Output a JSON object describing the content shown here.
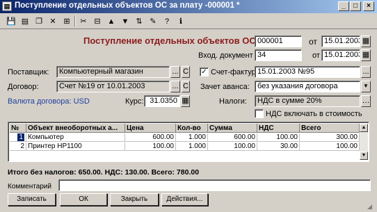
{
  "window": {
    "title": "Поступление отдельных объектов ОС за плату -000001 *",
    "title_icon": "doc-icon"
  },
  "toolbar": {
    "icons": [
      "save-icon",
      "print-icon",
      "copy-icon",
      "delete-icon",
      "mark-icon",
      "cut-icon",
      "struct-icon",
      "move-up-icon",
      "move-down-icon",
      "sort-icon",
      "edit-icon",
      "help-icon",
      "info-icon"
    ]
  },
  "header": {
    "doc_title": "Поступление отдельных объектов ОС №",
    "doc_number": "000001",
    "from_label": "от",
    "doc_date": "15.01.2003",
    "in_doc_label": "Вход. документ №",
    "in_doc_number": "34",
    "in_doc_from_label": "от",
    "in_doc_date": "15.01.2003"
  },
  "supplier": {
    "label": "Поставщик:",
    "value": "Компьютерный магазин",
    "btn_dots": "...",
    "btn_c": "С"
  },
  "invoice": {
    "label": "Счет-фактура:",
    "checked": true,
    "value": "15.01.2003 №95",
    "btn_dots": "..."
  },
  "contract": {
    "label": "Договор:",
    "value": "Счет №19 от 10.01.2003",
    "btn_dots": "...",
    "btn_c": "С"
  },
  "advance": {
    "label": "Зачет аванса:",
    "value": "без указания договора"
  },
  "currency": {
    "label": "Валюта договора: USD"
  },
  "rate": {
    "label": "Курс:",
    "value": "31.0350"
  },
  "taxes": {
    "label": "Налоги:",
    "value": "НДС в сумме 20%"
  },
  "vat_include": {
    "label": "НДС включать в стоимость",
    "checked": false
  },
  "table": {
    "headers": [
      "№",
      "Объект внеоборотных а...",
      "Цена",
      "Кол-во",
      "Сумма",
      "НДС",
      "Всего"
    ],
    "rows": [
      [
        "1",
        "Компьютер",
        "600.00",
        "1.000",
        "600.00",
        "100.00",
        "300.00"
      ],
      [
        "2",
        "Принтер HP1100",
        "100.00",
        "1.000",
        "100.00",
        "30.00",
        "100.00"
      ]
    ]
  },
  "totals": {
    "text": "Итого без налогов: 650.00. НДС: 130.00. Всего: 780.00"
  },
  "comment": {
    "label": "Комментарий",
    "value": ""
  },
  "buttons": {
    "write": "Записать",
    "ok": "ОК",
    "close": "Закрыть",
    "actions": "Действия..."
  }
}
